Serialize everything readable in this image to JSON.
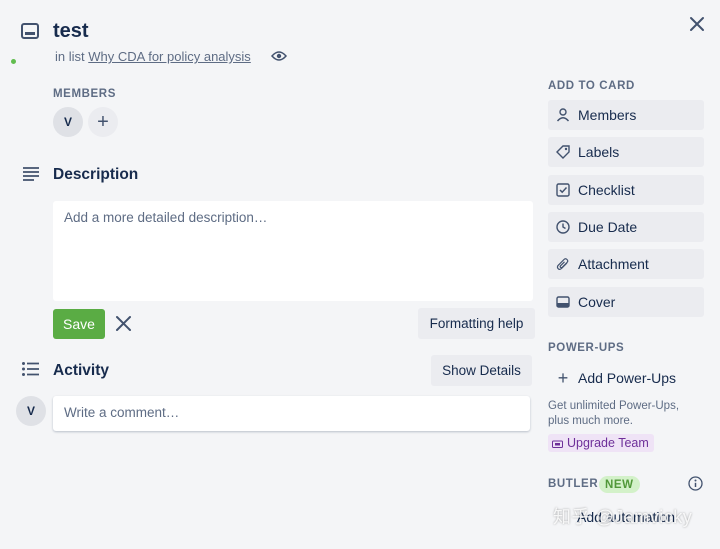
{
  "header": {
    "title": "test",
    "in_list_prefix": "in list",
    "list_name": "Why CDA for policy analysis"
  },
  "members": {
    "label": "MEMBERS",
    "avatar_initial": "V",
    "add_symbol": "+"
  },
  "description": {
    "heading": "Description",
    "placeholder": "Add a more detailed description…",
    "save_label": "Save",
    "formatting_help": "Formatting help"
  },
  "activity": {
    "heading": "Activity",
    "show_details": "Show Details",
    "avatar_initial": "V",
    "comment_placeholder": "Write a comment…"
  },
  "sidebar": {
    "add_to_card_label": "ADD TO CARD",
    "items": [
      {
        "label": "Members",
        "icon": "person-icon"
      },
      {
        "label": "Labels",
        "icon": "tag-icon"
      },
      {
        "label": "Checklist",
        "icon": "checkbox-icon"
      },
      {
        "label": "Due Date",
        "icon": "clock-icon"
      },
      {
        "label": "Attachment",
        "icon": "paperclip-icon"
      },
      {
        "label": "Cover",
        "icon": "cover-icon"
      }
    ],
    "powerups_label": "POWER-UPS",
    "add_powerups": "Add Power-Ups",
    "powerups_note": "Get unlimited Power-Ups, plus much more.",
    "upgrade_team": "Upgrade Team",
    "butler_label": "BUTLER",
    "new_badge": "NEW",
    "add_automation": "Add automation"
  },
  "watermark": "知乎 @Jamvicky",
  "colors": {
    "background": "#f4f5f7",
    "save_button": "#5aac44",
    "upgrade_bg": "#efe3f6",
    "new_badge_bg": "#d3f1c9"
  }
}
